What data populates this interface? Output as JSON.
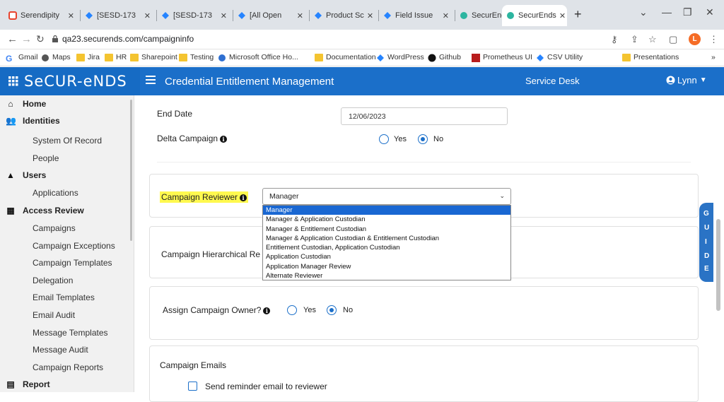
{
  "browser": {
    "tabs": [
      {
        "label": "Serendipity",
        "icon": "serendipity-icon"
      },
      {
        "label": "[SESD-173",
        "icon": "jira-icon"
      },
      {
        "label": "[SESD-173",
        "icon": "jira-icon"
      },
      {
        "label": "[All Open",
        "icon": "jira-icon"
      },
      {
        "label": "Product Sc",
        "icon": "jira-icon"
      },
      {
        "label": "Field Issue",
        "icon": "jira-icon"
      },
      {
        "label": "SecurEnds",
        "icon": "securends-icon"
      },
      {
        "label": "SecurEnds",
        "icon": "securends-icon"
      }
    ],
    "url": "qa23.securends.com/campaigninfo",
    "profile_initial": "L",
    "bookmarks": [
      {
        "label": "Gmail",
        "icon": "google-icon"
      },
      {
        "label": "Maps",
        "icon": "maps-icon"
      },
      {
        "label": "Jira",
        "icon": "folder-icon"
      },
      {
        "label": "HR",
        "icon": "folder-icon"
      },
      {
        "label": "Sharepoint",
        "icon": "folder-icon"
      },
      {
        "label": "Testing",
        "icon": "folder-icon"
      },
      {
        "label": "Microsoft Office Ho...",
        "icon": "office-icon"
      },
      {
        "label": "Documentation",
        "icon": "folder-icon"
      },
      {
        "label": "WordPress",
        "icon": "jira-icon"
      },
      {
        "label": "Github",
        "icon": "github-icon"
      },
      {
        "label": "Prometheus UI",
        "icon": "prometheus-icon"
      },
      {
        "label": "CSV Utility",
        "icon": "jira-icon"
      },
      {
        "label": "Presentations",
        "icon": "folder-icon"
      }
    ],
    "bookmarks_more": "»"
  },
  "app": {
    "logo": "SeCUR-eNDS",
    "title": "Credential Entitlement Management",
    "service_desk": "Service Desk",
    "user": "Lynn"
  },
  "sidebar": {
    "items": [
      {
        "label": "Home",
        "level": "top",
        "icon": "home-icon"
      },
      {
        "label": "Identities",
        "level": "top",
        "icon": "identities-icon"
      },
      {
        "label": "System Of Record",
        "level": "sub"
      },
      {
        "label": "People",
        "level": "sub"
      },
      {
        "label": "Users",
        "level": "top",
        "icon": "user-icon"
      },
      {
        "label": "Applications",
        "level": "sub"
      },
      {
        "label": "Access Review",
        "level": "top",
        "icon": "grid-icon"
      },
      {
        "label": "Campaigns",
        "level": "sub"
      },
      {
        "label": "Campaign Exceptions",
        "level": "sub"
      },
      {
        "label": "Campaign Templates",
        "level": "sub"
      },
      {
        "label": "Delegation",
        "level": "sub"
      },
      {
        "label": "Email Templates",
        "level": "sub"
      },
      {
        "label": "Email Audit",
        "level": "sub"
      },
      {
        "label": "Message Templates",
        "level": "sub"
      },
      {
        "label": "Message Audit",
        "level": "sub"
      },
      {
        "label": "Campaign Reports",
        "level": "sub"
      },
      {
        "label": "Report",
        "level": "top",
        "icon": "report-icon"
      }
    ]
  },
  "form": {
    "end_date_label": "End Date",
    "end_date_value": "12/06/2023",
    "delta_label": "Delta Campaign",
    "yes": "Yes",
    "no": "No",
    "reviewer_label": "Campaign Reviewer",
    "reviewer_selected": "Manager",
    "reviewer_options": [
      "Manager",
      "Manager & Application Custodian",
      "Manager & Entitlement Custodian",
      "Manager & Application Custodian & Entitlement Custodian",
      "Entitlement Custodian, Application Custodian",
      "Application Custodian",
      "Application Manager Review",
      "Alternate Reviewer"
    ],
    "hierarchical_label": "Campaign Hierarchical Re",
    "owner_label": "Assign Campaign Owner?",
    "emails_label": "Campaign Emails",
    "reminder_label": "Send reminder email to reviewer"
  },
  "guide": [
    "G",
    "U",
    "I",
    "D",
    "E"
  ]
}
